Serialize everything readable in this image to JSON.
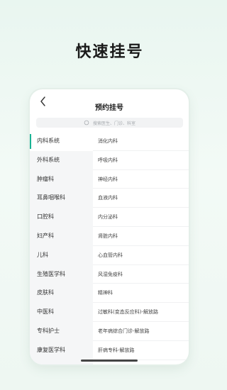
{
  "hero": {
    "title": "快速挂号"
  },
  "navbar": {
    "title": "预约挂号"
  },
  "search": {
    "placeholder": "搜索医生、门诊、科室"
  },
  "departments": [
    "内科系统",
    "外科系统",
    "肿瘤科",
    "耳鼻咽喉科",
    "口腔科",
    "妇产科",
    "儿科",
    "生殖医学科",
    "皮肤科",
    "中医科",
    "专科护士",
    "康复医学科"
  ],
  "active_department_index": 0,
  "sub_departments": [
    "消化内科",
    "呼吸内科",
    "神经内科",
    "血液内科",
    "内分泌科",
    "肾脏内科",
    "心血管内科",
    "风湿免疫科",
    "精神科",
    "过敏科(变态反应科)-解放路",
    "老年病综合门诊-解放路",
    "肝病专科-解放路"
  ],
  "colors": {
    "accent": "#1ab394"
  }
}
